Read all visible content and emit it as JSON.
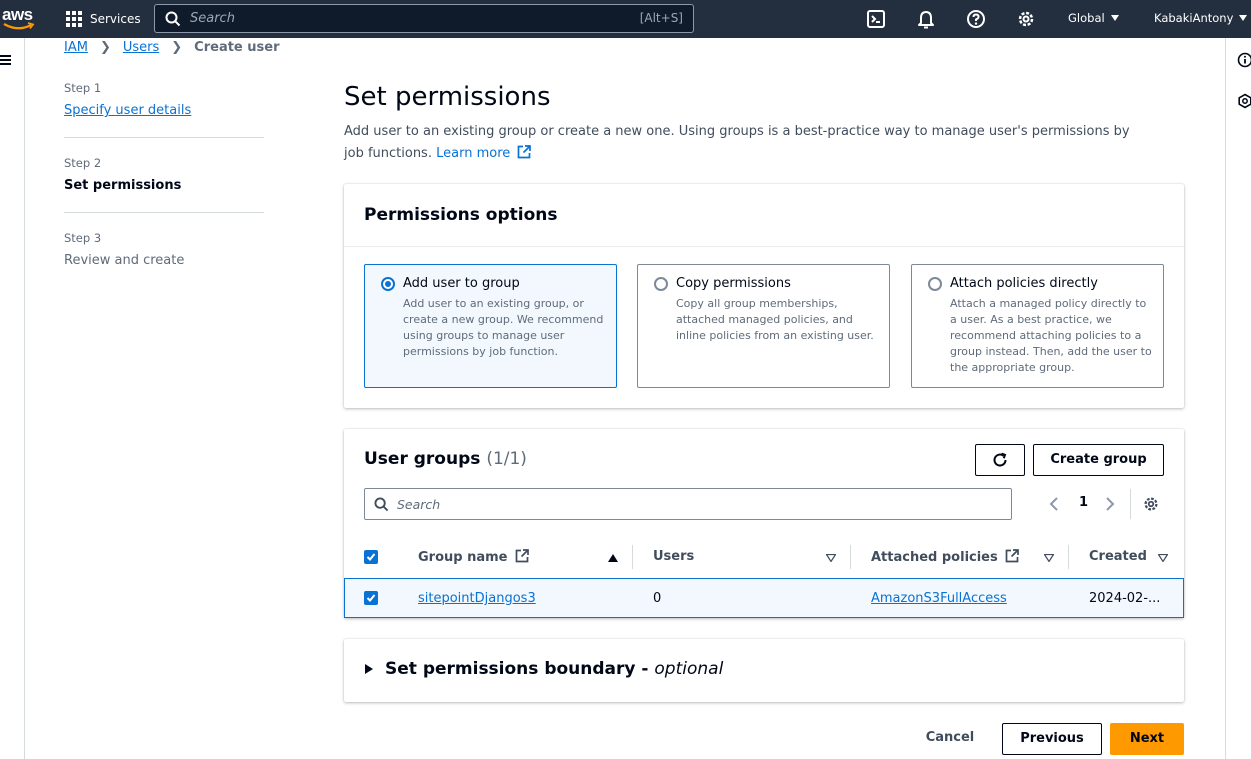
{
  "topnav": {
    "logo_text": "aws",
    "services_label": "Services",
    "search_placeholder": "Search",
    "search_shortcut": "[Alt+S]",
    "region_label": "Global",
    "account_label": "KabakiAntony"
  },
  "breadcrumb": {
    "items": [
      "IAM",
      "Users"
    ],
    "current": "Create user"
  },
  "steps": [
    {
      "label": "Step 1",
      "name": "Specify user details",
      "state": "link"
    },
    {
      "label": "Step 2",
      "name": "Set permissions",
      "state": "active"
    },
    {
      "label": "Step 3",
      "name": "Review and create",
      "state": "disabled"
    }
  ],
  "main": {
    "title": "Set permissions",
    "description": "Add user to an existing group or create a new one. Using groups is a best-practice way to manage user's permissions by job functions.",
    "learn_more": "Learn more"
  },
  "permissions_options": {
    "title": "Permissions options",
    "options": [
      {
        "title": "Add user to group",
        "desc": "Add user to an existing group, or create a new group. We recommend using groups to manage user permissions by job function.",
        "selected": true
      },
      {
        "title": "Copy permissions",
        "desc": "Copy all group memberships, attached managed policies, and inline policies from an existing user.",
        "selected": false
      },
      {
        "title": "Attach policies directly",
        "desc": "Attach a managed policy directly to a user. As a best practice, we recommend attaching policies to a group instead. Then, add the user to the appropriate group.",
        "selected": false
      }
    ]
  },
  "user_groups": {
    "title": "User groups",
    "count": "(1/1)",
    "create_group_label": "Create group",
    "search_placeholder": "Search",
    "page": "1",
    "columns": [
      "Group name",
      "Users",
      "Attached policies",
      "Created"
    ],
    "rows": [
      {
        "group_name": "sitepointDjangos3",
        "users": "0",
        "attached_policies": "AmazonS3FullAccess",
        "created": "2024-02-..."
      }
    ]
  },
  "boundary": {
    "title": "Set permissions boundary - ",
    "optional": "optional"
  },
  "footer": {
    "cancel": "Cancel",
    "previous": "Previous",
    "next": "Next"
  },
  "colors": {
    "nav_bg": "#232f3e",
    "link": "#0972d3",
    "primary_button": "#ff9900",
    "selected_bg": "#f2f8fd"
  }
}
